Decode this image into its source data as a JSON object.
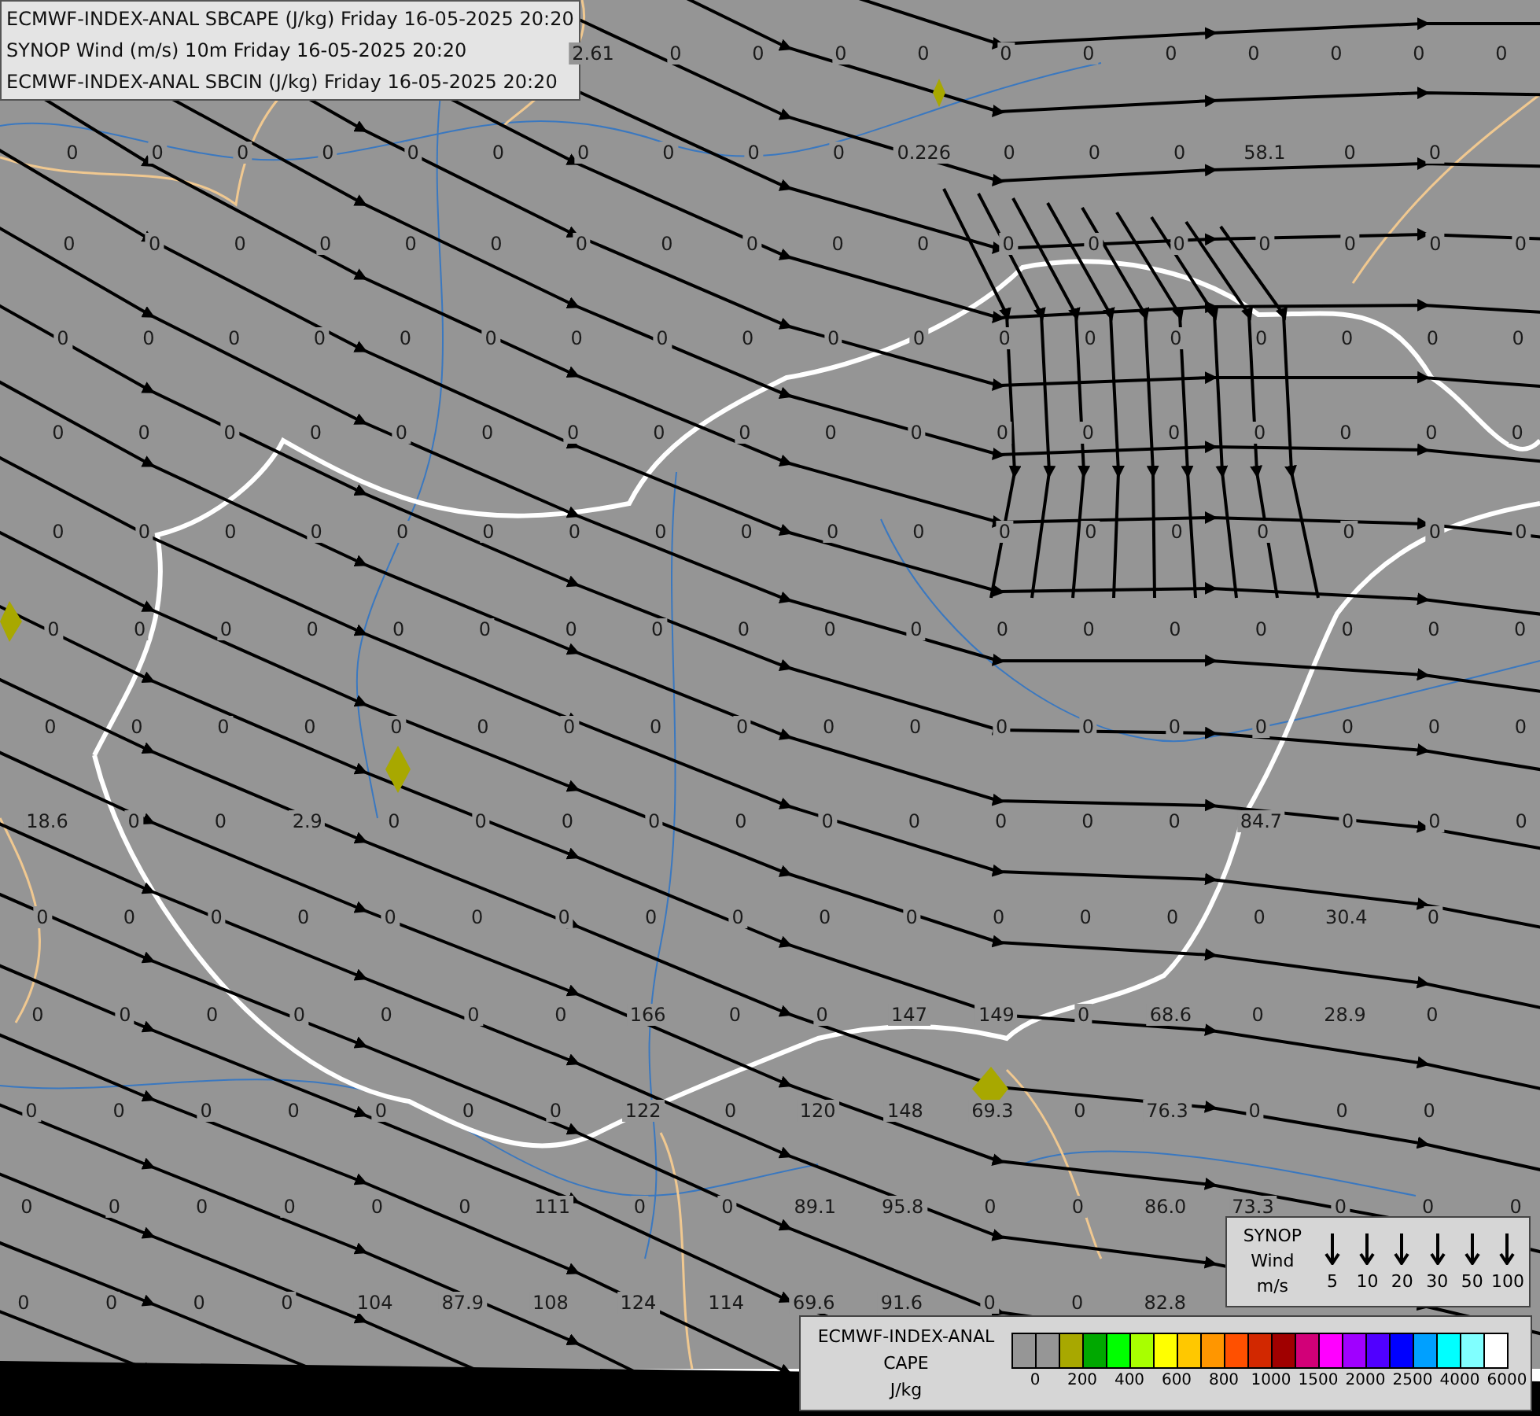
{
  "titles": [
    "ECMWF-INDEX-ANAL SBCAPE (J/kg) Friday 16-05-2025 20:20",
    "SYNOP Wind (m/s) 10m Friday 16-05-2025 20:20",
    "ECMWF-INDEX-ANAL SBCIN (J/kg) Friday 16-05-2025 20:20"
  ],
  "cape_values": {
    "rows": [
      [
        null,
        null,
        null,
        null,
        null,
        null,
        "2.61",
        "0",
        "0",
        "0",
        "0",
        "0",
        "0",
        "0",
        "0",
        "0",
        "0",
        "0"
      ],
      [
        "0",
        "0",
        "0",
        "0",
        "0",
        "0",
        "0",
        "0",
        "0",
        "0",
        "0.226",
        "0",
        "0",
        "0",
        "58.1",
        "0",
        "0"
      ],
      [
        "0",
        "0",
        "0",
        "0",
        "0",
        "0",
        "0",
        "0",
        "0",
        "0",
        "0",
        "0",
        "0",
        "0",
        "0",
        "0",
        "0",
        "0"
      ],
      [
        "0",
        "0",
        "0",
        "0",
        "0",
        "0",
        "0",
        "0",
        "0",
        "0",
        "0",
        "0",
        "0",
        "0",
        "0",
        "0",
        "0",
        "0"
      ],
      [
        "0",
        "0",
        "0",
        "0",
        "0",
        "0",
        "0",
        "0",
        "0",
        "0",
        "0",
        "0",
        "0",
        "0",
        "0",
        "0",
        "0",
        "0"
      ],
      [
        "0",
        "0",
        "0",
        "0",
        "0",
        "0",
        "0",
        "0",
        "0",
        "0",
        "0",
        "0",
        "0",
        "0",
        "0",
        "0",
        "0",
        "0"
      ],
      [
        "0",
        "0",
        "0",
        "0",
        "0",
        "0",
        "0",
        "0",
        "0",
        "0",
        "0",
        "0",
        "0",
        "0",
        "0",
        "0",
        "0",
        "0"
      ],
      [
        "0",
        "0",
        "0",
        "0",
        "0",
        "0",
        "0",
        "0",
        "0",
        "0",
        "0",
        "0",
        "0",
        "0",
        "0",
        "0",
        "0",
        "0"
      ],
      [
        "18.6",
        "0",
        "0",
        "2.9",
        "0",
        "0",
        "0",
        "0",
        "0",
        "0",
        "0",
        "0",
        "0",
        "0",
        "84.7",
        "0",
        "0",
        "0"
      ],
      [
        "0",
        "0",
        "0",
        "0",
        "0",
        "0",
        "0",
        "0",
        "0",
        "0",
        "0",
        "0",
        "0",
        "0",
        "0",
        "30.4",
        "0"
      ],
      [
        "0",
        "0",
        "0",
        "0",
        "0",
        "0",
        "0",
        "166",
        "0",
        "0",
        "147",
        "149",
        "0",
        "68.6",
        "0",
        "28.9",
        "0"
      ],
      [
        "0",
        "0",
        "0",
        "0",
        "0",
        "0",
        "0",
        "122",
        "0",
        "120",
        "148",
        "69.3",
        "0",
        "76.3",
        "0",
        "0",
        "0"
      ],
      [
        "0",
        "0",
        "0",
        "0",
        "0",
        "0",
        "111",
        "0",
        "0",
        "89.1",
        "95.8",
        "0",
        "0",
        "86.0",
        "73.3",
        "0",
        "0",
        "0"
      ],
      [
        "0",
        "0",
        "0",
        "0",
        "104",
        "87.9",
        "108",
        "124",
        "114",
        "69.6",
        "91.6",
        "0",
        "0",
        "82.8"
      ]
    ]
  },
  "wind_legend": {
    "title_lines": [
      "SYNOP",
      "Wind",
      "m/s"
    ],
    "speeds": [
      "5",
      "10",
      "20",
      "30",
      "50",
      "100"
    ]
  },
  "cape_legend": {
    "title_lines": [
      "ECMWF-INDEX-ANAL",
      "CAPE",
      "J/kg"
    ],
    "swatches": [
      {
        "color": "#969696"
      },
      {
        "color": "#969696"
      },
      {
        "color": "#a8a800"
      },
      {
        "color": "#00a800"
      },
      {
        "color": "#00ff00"
      },
      {
        "color": "#a8ff00"
      },
      {
        "color": "#ffff00"
      },
      {
        "color": "#ffc800"
      },
      {
        "color": "#ff9600"
      },
      {
        "color": "#ff5000"
      },
      {
        "color": "#d22800"
      },
      {
        "color": "#a00000"
      },
      {
        "color": "#d20078"
      },
      {
        "color": "#ff00ff"
      },
      {
        "color": "#a000ff"
      },
      {
        "color": "#5000ff"
      },
      {
        "color": "#0000ff"
      },
      {
        "color": "#00a0ff"
      },
      {
        "color": "#00ffff"
      },
      {
        "color": "#80ffff"
      },
      {
        "color": "#ffffff"
      }
    ],
    "ticks": [
      "0",
      "200",
      "400",
      "600",
      "800",
      "1000",
      "1500",
      "2000",
      "2500",
      "4000",
      "6000"
    ]
  }
}
